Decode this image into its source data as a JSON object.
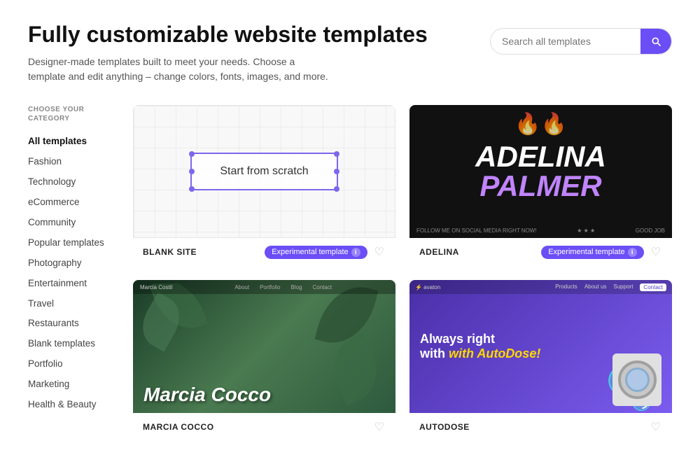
{
  "header": {
    "title": "Fully customizable website templates",
    "subtitle": "Designer-made templates built to meet your needs. Choose a template and edit anything – change colors, fonts, images, and more."
  },
  "search": {
    "placeholder": "Search all templates",
    "button_label": "Search"
  },
  "sidebar": {
    "section_label": "CHOOSE YOUR CATEGORY",
    "items": [
      {
        "id": "all-templates",
        "label": "All templates",
        "active": true
      },
      {
        "id": "fashion",
        "label": "Fashion",
        "active": false
      },
      {
        "id": "technology",
        "label": "Technology",
        "active": false
      },
      {
        "id": "ecommerce",
        "label": "eCommerce",
        "active": false
      },
      {
        "id": "community",
        "label": "Community",
        "active": false
      },
      {
        "id": "popular-templates",
        "label": "Popular templates",
        "active": false
      },
      {
        "id": "photography",
        "label": "Photography",
        "active": false
      },
      {
        "id": "entertainment",
        "label": "Entertainment",
        "active": false
      },
      {
        "id": "travel",
        "label": "Travel",
        "active": false
      },
      {
        "id": "restaurants",
        "label": "Restaurants",
        "active": false
      },
      {
        "id": "blank-templates",
        "label": "Blank templates",
        "active": false
      },
      {
        "id": "portfolio",
        "label": "Portfolio",
        "active": false
      },
      {
        "id": "marketing",
        "label": "Marketing",
        "active": false
      },
      {
        "id": "health-beauty",
        "label": "Health & Beauty",
        "active": false
      }
    ]
  },
  "templates": {
    "cards": [
      {
        "id": "blank-site",
        "name": "BLANK SITE",
        "type": "blank",
        "badge": "Experimental template",
        "badge_show": true,
        "start_text": "Start from scratch"
      },
      {
        "id": "adelina",
        "name": "ADELINA",
        "type": "adelina",
        "badge": "Experimental template",
        "badge_show": true,
        "title_line1": "ADELINA",
        "title_line2": "Palmer"
      },
      {
        "id": "marcia-cocco",
        "name": "MARCIA COCCO",
        "type": "marcia",
        "badge_show": false,
        "title": "Marcia Cocco"
      },
      {
        "id": "autodose",
        "name": "AUTODOSE",
        "type": "autodose",
        "badge_show": false,
        "line1": "Always right",
        "line2": "with AutoDose!"
      }
    ]
  }
}
